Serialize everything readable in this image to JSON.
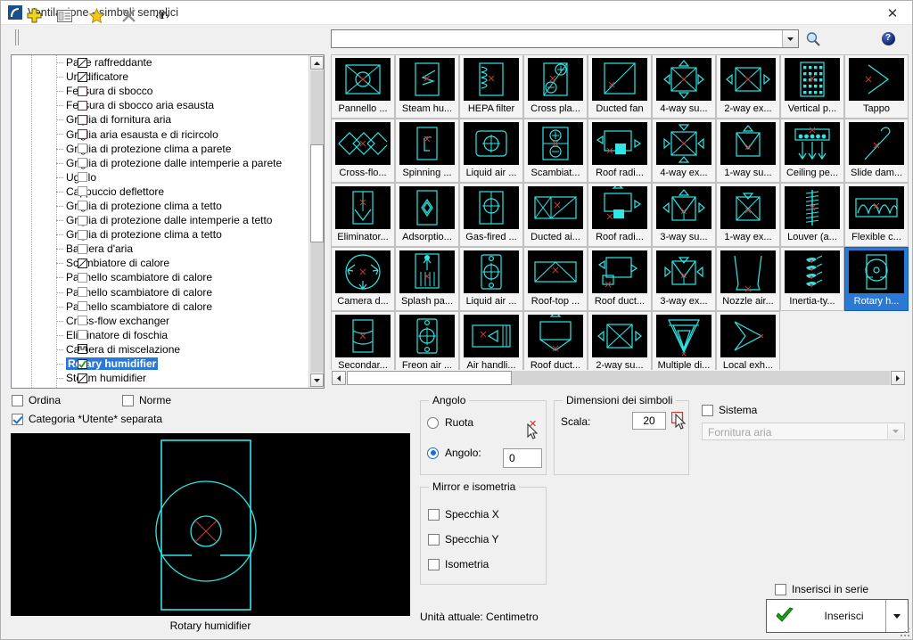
{
  "window": {
    "title": "Ventilazione - simboli semplici",
    "close_label": "✕",
    "app_icon": "cad-window-icon"
  },
  "toolbar": {
    "buttons": [
      {
        "name": "add-symbol-button",
        "icon": "green-plus-icon",
        "label": "+"
      },
      {
        "name": "properties-button",
        "icon": "list-properties-icon",
        "label": ""
      },
      {
        "name": "favorites-button",
        "icon": "star-icon",
        "label": ""
      },
      {
        "name": "delete-button",
        "icon": "close-x-icon",
        "label": "✕"
      },
      {
        "name": "text-button",
        "icon": "text-tag-icon",
        "label": "‹T›"
      }
    ],
    "search": {
      "value": "",
      "placeholder": ""
    },
    "search_icon": "magnifier-icon",
    "help_label": "?"
  },
  "tree": {
    "items": [
      {
        "label": "Parte raffreddante",
        "state": "diagonal"
      },
      {
        "label": "Umidificatore",
        "state": "diagonal"
      },
      {
        "label": "Fessura di sbocco",
        "state": "red"
      },
      {
        "label": "Fessura di sbocco aria esausta",
        "state": "red"
      },
      {
        "label": "Griglia di fornitura aria",
        "state": "red"
      },
      {
        "label": "Griglia aria esausta e di ricircolo",
        "state": "red"
      },
      {
        "label": "Griglia di protezione clima a parete",
        "state": "empty"
      },
      {
        "label": "Griglia di protezione dalle intemperie a parete",
        "state": "empty"
      },
      {
        "label": "Ugello",
        "state": "empty"
      },
      {
        "label": "Cappuccio deflettore",
        "state": "empty"
      },
      {
        "label": "Griglia di protezione clima a tetto",
        "state": "empty"
      },
      {
        "label": "Griglia di protezione dalle intemperie a tetto",
        "state": "empty"
      },
      {
        "label": "Griglia di protezione clima a tetto",
        "state": "empty"
      },
      {
        "label": "Barriera d'aria",
        "state": "empty"
      },
      {
        "label": "Scambiatore di calore",
        "state": "diagonal"
      },
      {
        "label": "Pannello scambiatore di calore",
        "state": "empty"
      },
      {
        "label": "Pannello scambiatore di calore",
        "state": "empty"
      },
      {
        "label": "Pannello scambiatore di calore",
        "state": "empty"
      },
      {
        "label": "Cross-flow exchanger",
        "state": "empty"
      },
      {
        "label": "Eliminatore di foschia",
        "state": "empty"
      },
      {
        "label": "Camera di miscelazione",
        "state": "chamber"
      },
      {
        "label": "Rotary humidifier",
        "state": "checked",
        "selected": true
      },
      {
        "label": "Steam humidifier",
        "state": "diagonal"
      }
    ]
  },
  "symbols": {
    "selected_index": 30,
    "items": [
      {
        "label": "Pannello ...",
        "icon": "panel-cooler-symbol"
      },
      {
        "label": "Steam hu...",
        "icon": "steam-humidifier-symbol"
      },
      {
        "label": "HEPA filter",
        "icon": "hepa-filter-symbol"
      },
      {
        "label": "Cross pla...",
        "icon": "cross-plate-symbol"
      },
      {
        "label": "Ducted fan",
        "icon": "ducted-fan-symbol"
      },
      {
        "label": "4-way su...",
        "icon": "four-way-supply-symbol"
      },
      {
        "label": "2-way ex...",
        "icon": "two-way-exhaust-symbol"
      },
      {
        "label": "Vertical p...",
        "icon": "vertical-plate-symbol"
      },
      {
        "label": "Tappo",
        "icon": "cap-symbol"
      },
      {
        "label": "Cross-flo...",
        "icon": "cross-flow-symbol"
      },
      {
        "label": "Spinning ...",
        "icon": "spinning-symbol"
      },
      {
        "label": "Liquid air ...",
        "icon": "liquid-air-symbol"
      },
      {
        "label": "Scambiat...",
        "icon": "exchanger-symbol"
      },
      {
        "label": "Roof radi...",
        "icon": "roof-radial-symbol"
      },
      {
        "label": "4-way ex...",
        "icon": "four-way-exhaust-symbol"
      },
      {
        "label": "1-way su...",
        "icon": "one-way-supply-symbol"
      },
      {
        "label": "Ceiling pe...",
        "icon": "ceiling-perforated-symbol"
      },
      {
        "label": "Slide dam...",
        "icon": "slide-damper-symbol"
      },
      {
        "label": "Eliminator...",
        "icon": "eliminator-symbol"
      },
      {
        "label": "Adsorptio...",
        "icon": "adsorption-symbol"
      },
      {
        "label": "Gas-fired ...",
        "icon": "gas-fired-symbol"
      },
      {
        "label": "Ducted ai...",
        "icon": "ducted-air-symbol"
      },
      {
        "label": "Roof radi...",
        "icon": "roof-radial2-symbol"
      },
      {
        "label": "3-way su...",
        "icon": "three-way-supply-symbol"
      },
      {
        "label": "1-way ex...",
        "icon": "one-way-exhaust-symbol"
      },
      {
        "label": "Louver (a...",
        "icon": "louver-symbol"
      },
      {
        "label": "Flexible c...",
        "icon": "flexible-connector-symbol"
      },
      {
        "label": "Camera d...",
        "icon": "mixing-chamber-symbol"
      },
      {
        "label": "Splash pa...",
        "icon": "splash-pan-symbol"
      },
      {
        "label": "Liquid air ...",
        "icon": "liquid-air2-symbol"
      },
      {
        "label": "Roof-top ...",
        "icon": "roof-top-symbol"
      },
      {
        "label": "Roof duct...",
        "icon": "roof-duct-symbol"
      },
      {
        "label": "3-way ex...",
        "icon": "three-way-exhaust-symbol"
      },
      {
        "label": "Nozzle air...",
        "icon": "nozzle-air-symbol"
      },
      {
        "label": "Inertia-ty...",
        "icon": "inertia-type-symbol"
      },
      {
        "label": "Rotary h...",
        "icon": "rotary-humidifier-symbol",
        "selected": true
      },
      {
        "label": "Secondar...",
        "icon": "secondary-symbol"
      },
      {
        "label": "Freon air ...",
        "icon": "freon-air-symbol"
      },
      {
        "label": "Air handli...",
        "icon": "air-handling-symbol"
      },
      {
        "label": "Roof duct...",
        "icon": "roof-duct2-symbol"
      },
      {
        "label": "2-way su...",
        "icon": "two-way-supply-symbol"
      },
      {
        "label": "Multiple di...",
        "icon": "multiple-diffuser-symbol"
      },
      {
        "label": "Local exh...",
        "icon": "local-exhaust-symbol"
      }
    ]
  },
  "options": {
    "ordina": {
      "label": "Ordina",
      "checked": false
    },
    "norme": {
      "label": "Norme",
      "checked": false
    },
    "categoria": {
      "label": "Categoria *Utente* separata",
      "checked": true
    }
  },
  "preview": {
    "caption": "Rotary humidifier"
  },
  "angolo": {
    "legend": "Angolo",
    "ruota_label": "Ruota",
    "ruota_selected": false,
    "angolo_label": "Angolo:",
    "angolo_selected": true,
    "angolo_value": "0"
  },
  "dimensioni": {
    "legend": "Dimensioni dei simboli",
    "scala_label": "Scala:",
    "scala_value": "20",
    "pick_icon": "pick-scale-icon"
  },
  "mirror": {
    "legend": "Mirror e isometria",
    "items": [
      {
        "label": "Specchia X",
        "checked": false
      },
      {
        "label": "Specchia Y",
        "checked": false
      },
      {
        "label": "Isometria",
        "checked": false
      }
    ]
  },
  "sistema": {
    "label": "Sistema",
    "checked": false,
    "dropdown_value": "Fornitura aria",
    "dropdown_icon": "chevron-down-icon"
  },
  "footer": {
    "units_text": "Unità attuale: Centimetro",
    "insert_series": {
      "label": "Inserisci in serie",
      "checked": false
    },
    "insert_button": {
      "label": "Inserisci",
      "icon": "green-check-icon",
      "split_icon": "chevron-down-icon"
    }
  },
  "colors": {
    "accent": "#2a79d4",
    "symbol_cyan": "#2fe6e6",
    "symbol_red": "#c23b3b",
    "canvas_black": "#000000",
    "window_bg": "#f0f0f0"
  }
}
